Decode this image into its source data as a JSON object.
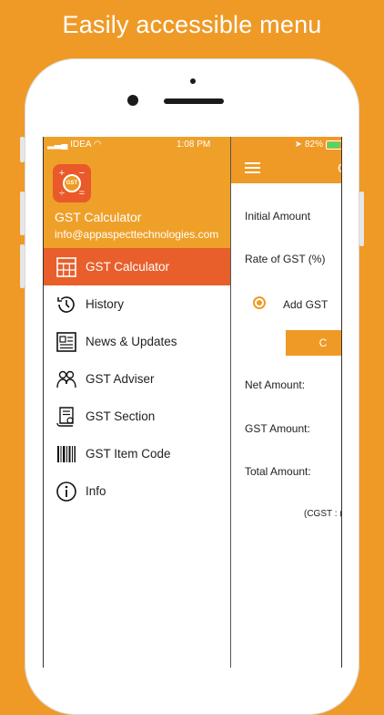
{
  "headline": "Easily accessible menu",
  "status_bar": {
    "carrier": "IDEA",
    "time": "1:08 PM",
    "battery": "82%"
  },
  "drawer": {
    "app_name": "GST Calculator",
    "email": "info@appaspecttechnologies.com",
    "logo_text": "GST",
    "items": [
      {
        "label": "GST Calculator",
        "icon": "calculator-icon",
        "active": true
      },
      {
        "label": "History",
        "icon": "history-icon",
        "active": false
      },
      {
        "label": "News & Updates",
        "icon": "newspaper-icon",
        "active": false
      },
      {
        "label": "GST Adviser",
        "icon": "advisers-icon",
        "active": false
      },
      {
        "label": "GST Section",
        "icon": "scroll-document-icon",
        "active": false
      },
      {
        "label": "GST Item Code",
        "icon": "barcode-icon",
        "active": false
      },
      {
        "label": "Info",
        "icon": "info-icon",
        "active": false
      }
    ]
  },
  "calculator": {
    "title_fragment": "C",
    "initial_amount_label": "Initial Amount",
    "rate_label": "Rate of GST (%)",
    "add_gst_label": "Add GST",
    "button_fragment": "C",
    "net_amount_label": "Net Amount:",
    "gst_amount_label": "GST Amount:",
    "total_amount_label": "Total Amount:",
    "note_fragment": "(CGST : ("
  },
  "colors": {
    "accent": "#ef9a26",
    "active_item": "#e85f2b",
    "battery": "#4cd964"
  }
}
